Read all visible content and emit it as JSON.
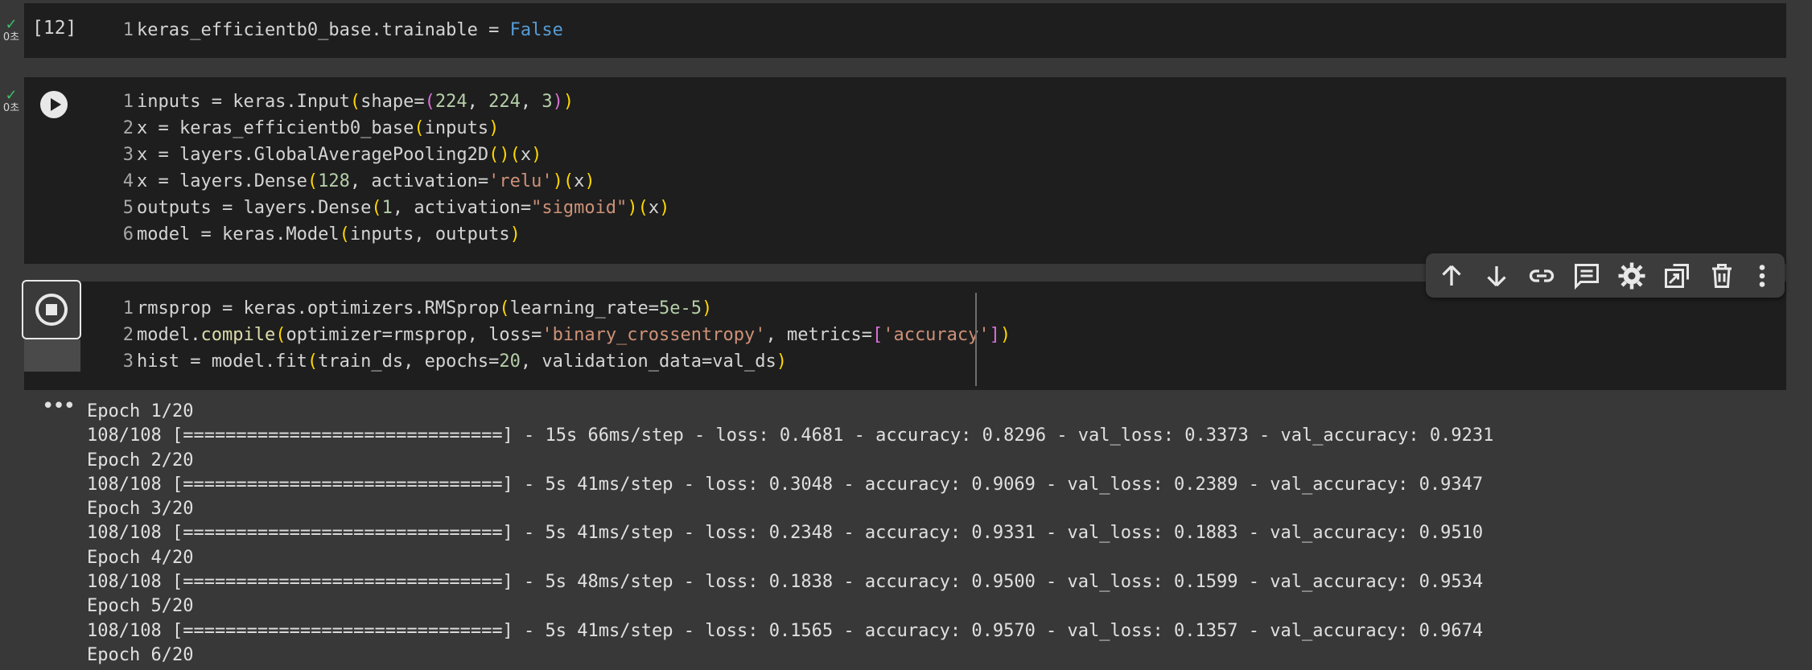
{
  "cells": [
    {
      "status": "0초",
      "exec_count": "[12]",
      "lines": [
        {
          "n": "1",
          "parts": [
            [
              "keras_efficientb0_base.trainable = ",
              ""
            ],
            [
              "False",
              "kw"
            ]
          ]
        }
      ]
    },
    {
      "status": "0초",
      "lines": [
        {
          "n": "1",
          "parts": [
            [
              "inputs = keras.Input",
              ""
            ],
            [
              "(",
              "p1"
            ],
            [
              "shape=",
              ""
            ],
            [
              "(",
              "p2"
            ],
            [
              "224",
              "num"
            ],
            [
              ", ",
              ""
            ],
            [
              "224",
              "num"
            ],
            [
              ", ",
              ""
            ],
            [
              "3",
              "num"
            ],
            [
              ")",
              "p2"
            ],
            [
              ")",
              "p1"
            ]
          ]
        },
        {
          "n": "2",
          "parts": [
            [
              "x = keras_efficientb0_base",
              ""
            ],
            [
              "(",
              "p1"
            ],
            [
              "inputs",
              ""
            ],
            [
              ")",
              "p1"
            ]
          ]
        },
        {
          "n": "3",
          "parts": [
            [
              "x = layers.GlobalAveragePooling2D",
              ""
            ],
            [
              "()",
              "p1"
            ],
            [
              "(",
              "p1"
            ],
            [
              "x",
              ""
            ],
            [
              ")",
              "p1"
            ]
          ]
        },
        {
          "n": "4",
          "parts": [
            [
              "x = layers.Dense",
              ""
            ],
            [
              "(",
              "p1"
            ],
            [
              "128",
              "num"
            ],
            [
              ", activation=",
              ""
            ],
            [
              "'relu'",
              "str"
            ],
            [
              ")",
              "p1"
            ],
            [
              "(",
              "p1"
            ],
            [
              "x",
              ""
            ],
            [
              ")",
              "p1"
            ]
          ]
        },
        {
          "n": "5",
          "parts": [
            [
              "outputs = layers.Dense",
              ""
            ],
            [
              "(",
              "p1"
            ],
            [
              "1",
              "num"
            ],
            [
              ", activation=",
              ""
            ],
            [
              "\"sigmoid\"",
              "str"
            ],
            [
              ")",
              "p1"
            ],
            [
              "(",
              "p1"
            ],
            [
              "x",
              ""
            ],
            [
              ")",
              "p1"
            ]
          ]
        },
        {
          "n": "6",
          "parts": [
            [
              "model = keras.Model",
              ""
            ],
            [
              "(",
              "p1"
            ],
            [
              "inputs, outputs",
              ""
            ],
            [
              ")",
              "p1"
            ]
          ]
        }
      ]
    },
    {
      "lines": [
        {
          "n": "1",
          "parts": [
            [
              "rmsprop = keras.optimizers.RMSprop",
              ""
            ],
            [
              "(",
              "p1"
            ],
            [
              "learning_rate=",
              ""
            ],
            [
              "5e-5",
              "num"
            ],
            [
              ")",
              "p1"
            ]
          ]
        },
        {
          "n": "2",
          "parts": [
            [
              "model.",
              ""
            ],
            [
              "compile",
              "fn"
            ],
            [
              "(",
              "p1"
            ],
            [
              "optimizer=rmsprop, loss=",
              ""
            ],
            [
              "'binary_crossentropy'",
              "str"
            ],
            [
              ", metrics=",
              ""
            ],
            [
              "[",
              "p2"
            ],
            [
              "'accuracy'",
              "str"
            ],
            [
              "]",
              "p2"
            ],
            [
              ")",
              "p1"
            ]
          ]
        },
        {
          "n": "3",
          "parts": [
            [
              "hist = model.fit",
              ""
            ],
            [
              "(",
              "p1"
            ],
            [
              "train_ds, epochs=",
              ""
            ],
            [
              "20",
              "num"
            ],
            [
              ", validation_data=val_ds",
              ""
            ],
            [
              ")",
              "p1"
            ]
          ]
        }
      ]
    }
  ],
  "toolbar": {
    "buttons": [
      {
        "name": "move-cell-up-button",
        "icon": "arrow-up-icon"
      },
      {
        "name": "move-cell-down-button",
        "icon": "arrow-down-icon"
      },
      {
        "name": "copy-link-button",
        "icon": "link-icon"
      },
      {
        "name": "add-comment-button",
        "icon": "comment-icon"
      },
      {
        "name": "cell-settings-button",
        "icon": "gear-icon"
      },
      {
        "name": "mirror-cell-button",
        "icon": "mirror-tab-icon"
      },
      {
        "name": "delete-cell-button",
        "icon": "trash-icon"
      },
      {
        "name": "more-actions-button",
        "icon": "more-vert-icon"
      }
    ]
  },
  "output": {
    "lines": [
      "Epoch 1/20",
      "108/108 [==============================] - 15s 66ms/step - loss: 0.4681 - accuracy: 0.8296 - val_loss: 0.3373 - val_accuracy: 0.9231",
      "Epoch 2/20",
      "108/108 [==============================] - 5s 41ms/step - loss: 0.3048 - accuracy: 0.9069 - val_loss: 0.2389 - val_accuracy: 0.9347",
      "Epoch 3/20",
      "108/108 [==============================] - 5s 41ms/step - loss: 0.2348 - accuracy: 0.9331 - val_loss: 0.1883 - val_accuracy: 0.9510",
      "Epoch 4/20",
      "108/108 [==============================] - 5s 48ms/step - loss: 0.1838 - accuracy: 0.9500 - val_loss: 0.1599 - val_accuracy: 0.9534",
      "Epoch 5/20",
      "108/108 [==============================] - 5s 41ms/step - loss: 0.1565 - accuracy: 0.9570 - val_loss: 0.1357 - val_accuracy: 0.9674",
      "Epoch 6/20"
    ]
  }
}
